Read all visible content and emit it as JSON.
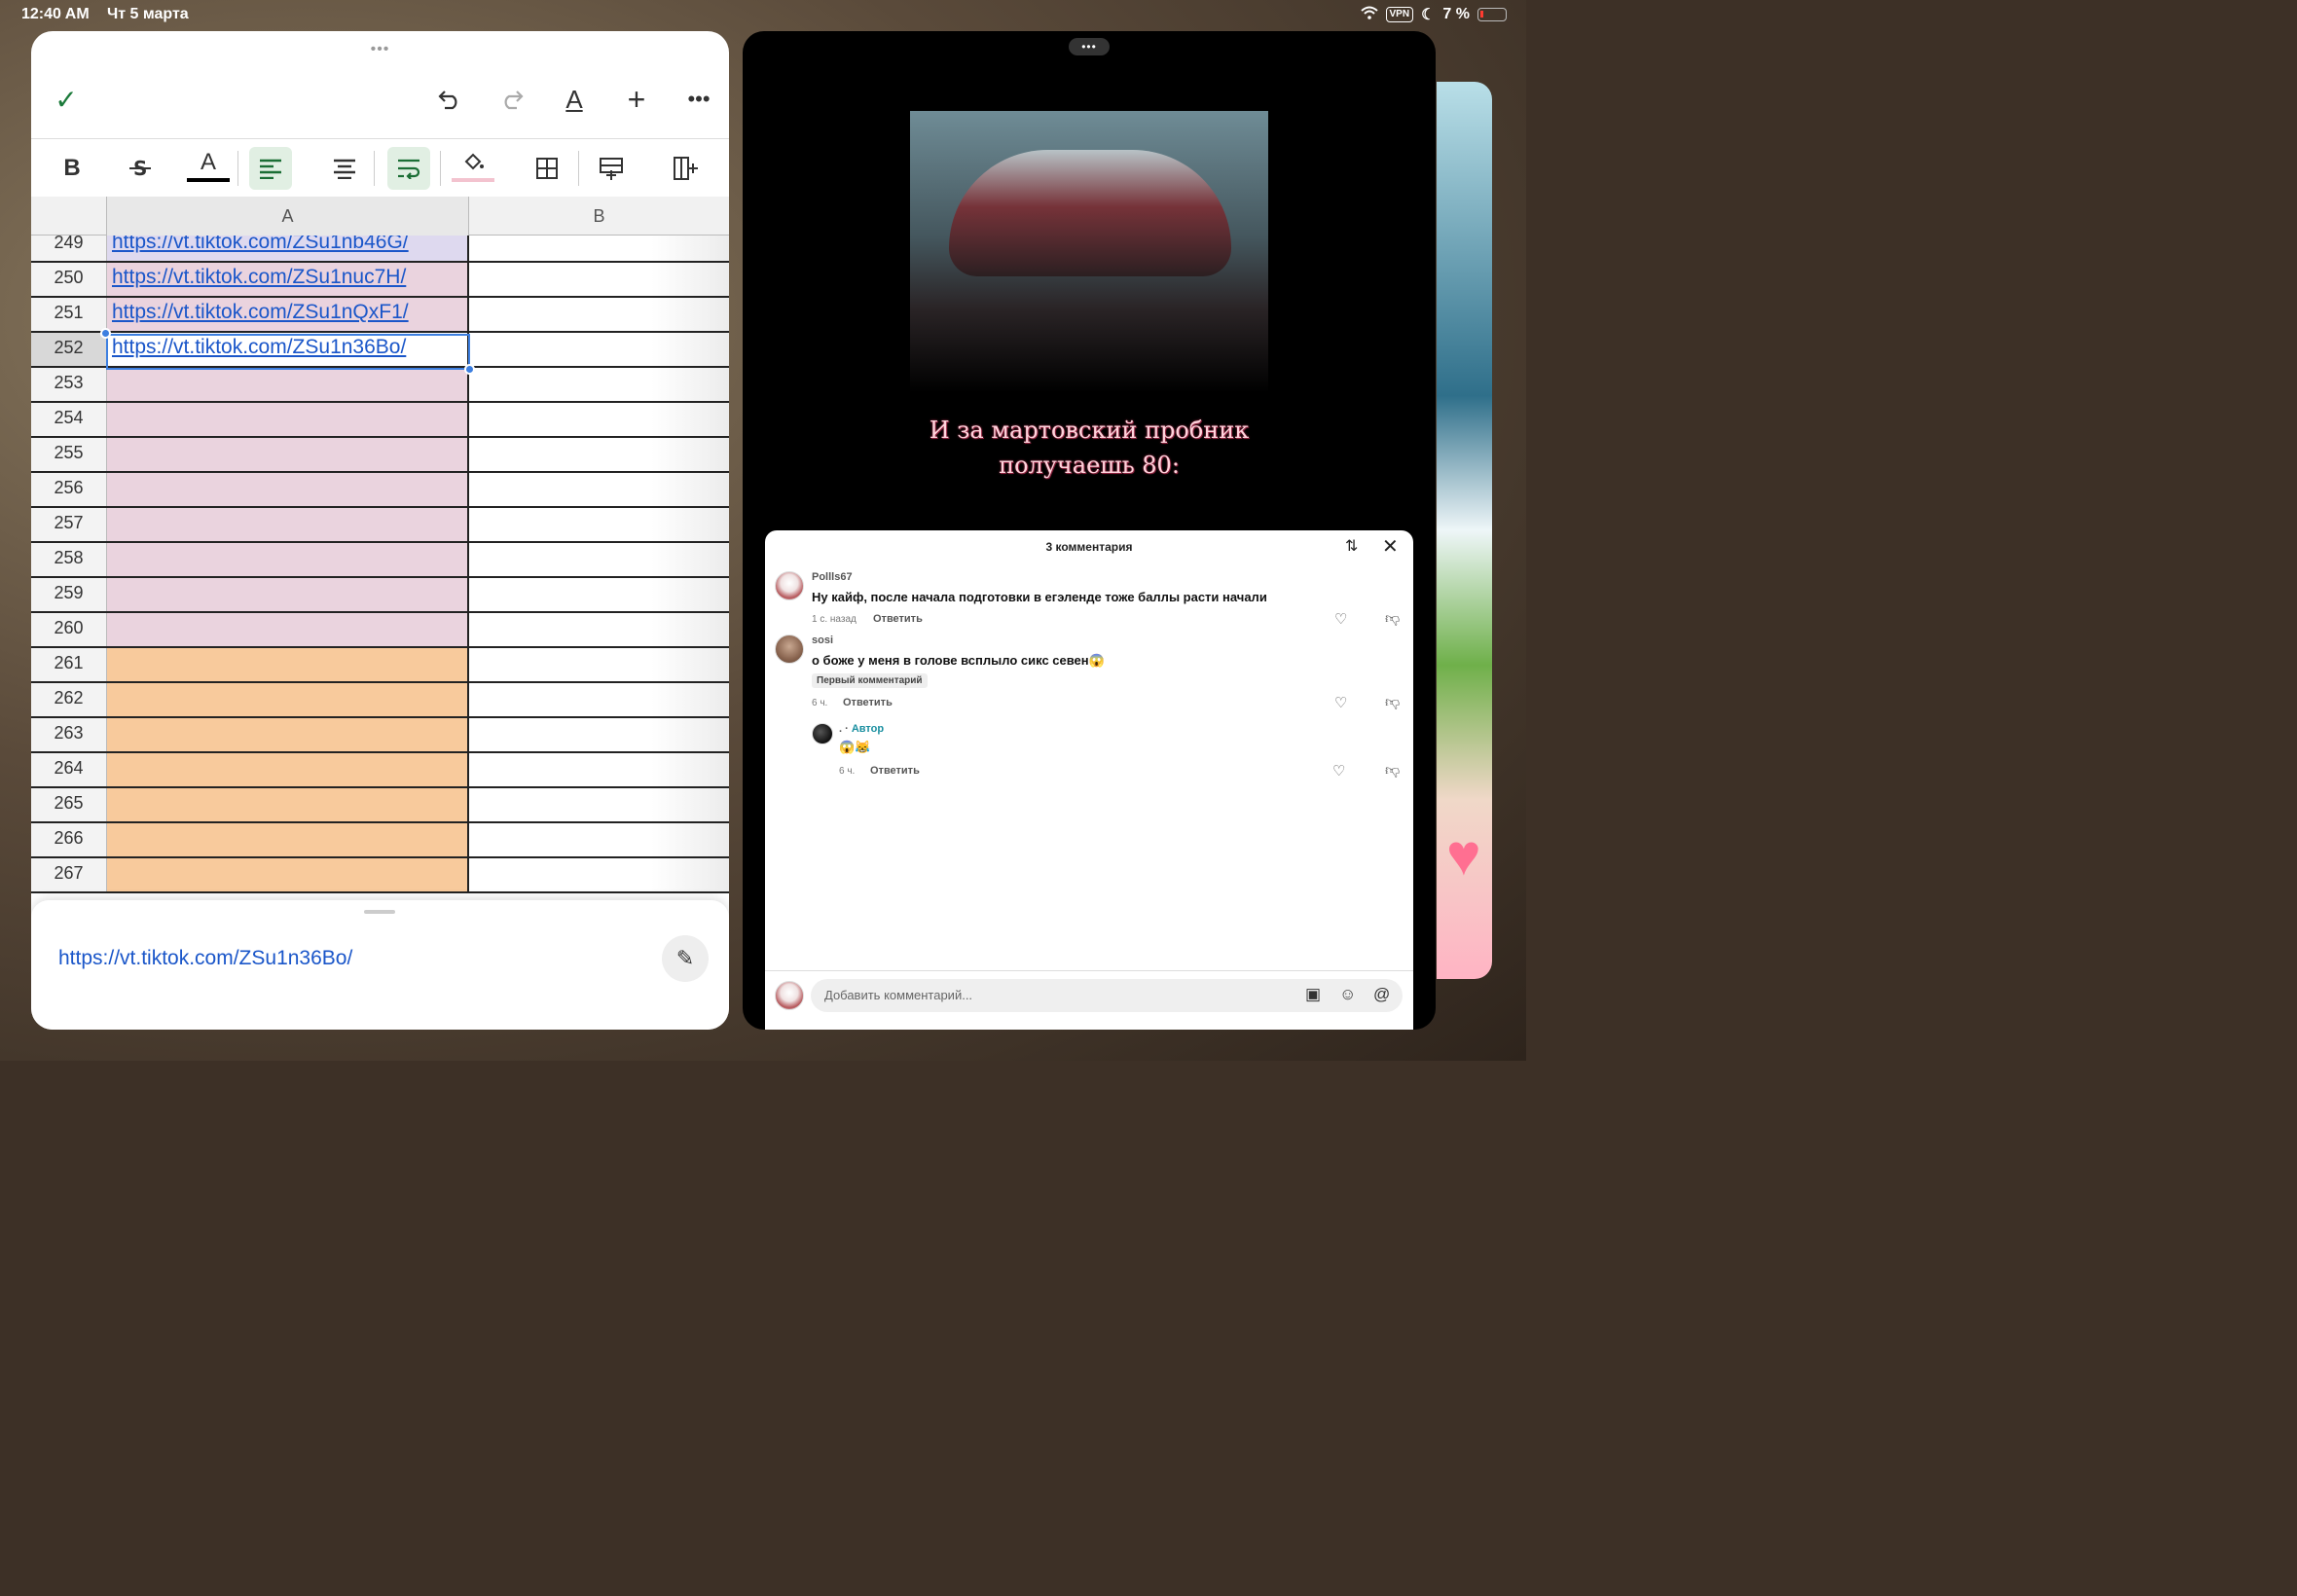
{
  "status": {
    "time": "12:40 AM",
    "date": "Чт 5 марта",
    "vpn": "VPN",
    "battery": "7 %"
  },
  "sheet": {
    "columns": [
      "A",
      "B"
    ],
    "rows": [
      {
        "num": "249",
        "a": "https://vt.tiktok.com/ZSu1nb46G/",
        "color": "#ded9ef"
      },
      {
        "num": "250",
        "a": "https://vt.tiktok.com/ZSu1nuc7H/",
        "color": "#ead3de"
      },
      {
        "num": "251",
        "a": "https://vt.tiktok.com/ZSu1nQxF1/",
        "color": "#ead3de"
      },
      {
        "num": "252",
        "a": "https://vt.tiktok.com/ZSu1n36Bo/",
        "color": "#ffffff",
        "selected": true
      },
      {
        "num": "253",
        "a": "",
        "color": "#ead3de"
      },
      {
        "num": "254",
        "a": "",
        "color": "#ead3de"
      },
      {
        "num": "255",
        "a": "",
        "color": "#ead3de"
      },
      {
        "num": "256",
        "a": "",
        "color": "#ead3de"
      },
      {
        "num": "257",
        "a": "",
        "color": "#ead3de"
      },
      {
        "num": "258",
        "a": "",
        "color": "#ead3de"
      },
      {
        "num": "259",
        "a": "",
        "color": "#ead3de"
      },
      {
        "num": "260",
        "a": "",
        "color": "#ead3de"
      },
      {
        "num": "261",
        "a": "",
        "color": "#f8ca9c"
      },
      {
        "num": "262",
        "a": "",
        "color": "#f8ca9c"
      },
      {
        "num": "263",
        "a": "",
        "color": "#f8ca9c"
      },
      {
        "num": "264",
        "a": "",
        "color": "#f8ca9c"
      },
      {
        "num": "265",
        "a": "",
        "color": "#f8ca9c"
      },
      {
        "num": "266",
        "a": "",
        "color": "#f8ca9c"
      },
      {
        "num": "267",
        "a": "",
        "color": "#f8ca9c"
      }
    ],
    "formula_value": "https://vt.tiktok.com/ZSu1n36Bo/",
    "toolbar": {
      "bold": "B",
      "text_color": "A",
      "format": "A"
    }
  },
  "video": {
    "caption_line1": "И за мартовский пробник",
    "caption_line2": "получаешь 80:"
  },
  "comments": {
    "title": "3 комментария",
    "items": [
      {
        "user": "Pollls67",
        "text": "Ну кайф, после начала подготовки в егэленде тоже баллы расти начали",
        "time": "1 с. назад",
        "reply": "Ответить"
      },
      {
        "user": "sosi",
        "text": "о боже у меня в голове всплыло сикс севен😱",
        "badge": "Первый комментарий",
        "time": "6 ч.",
        "reply": "Ответить"
      },
      {
        "user": ".",
        "author": "Автор",
        "text": "😱😹",
        "time": "6 ч.",
        "reply": "Ответить"
      }
    ],
    "input_placeholder": "Добавить комментарий..."
  }
}
